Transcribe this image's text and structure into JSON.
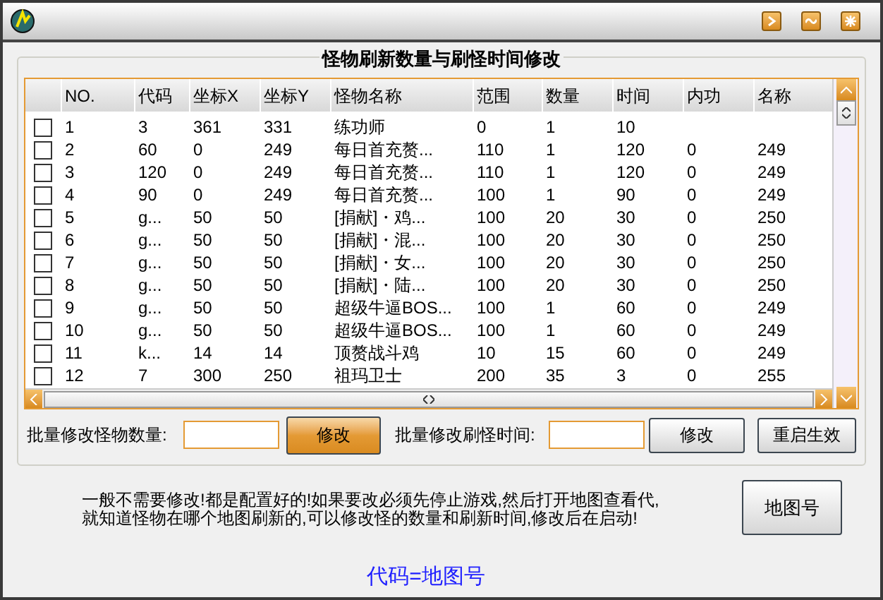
{
  "group_title": "怪物刷新数量与刷怪时间修改",
  "table": {
    "columns": [
      "NO.",
      "代码",
      "坐标X",
      "坐标Y",
      "怪物名称",
      "范围",
      "数量",
      "时间",
      "内功",
      "名称"
    ],
    "rows": [
      {
        "checked": false,
        "cells": [
          "1",
          "3",
          "361",
          "331",
          "练功师",
          "0",
          "1",
          "10",
          "",
          ""
        ]
      },
      {
        "checked": false,
        "cells": [
          "2",
          "60",
          "0",
          "249",
          "每日首充赘...",
          "110",
          "1",
          "120",
          "0",
          "249"
        ]
      },
      {
        "checked": false,
        "cells": [
          "3",
          "120",
          "0",
          "249",
          "每日首充赘...",
          "110",
          "1",
          "120",
          "0",
          "249"
        ]
      },
      {
        "checked": false,
        "cells": [
          "4",
          "90",
          "0",
          "249",
          "每日首充赘...",
          "100",
          "1",
          "90",
          "0",
          "249"
        ]
      },
      {
        "checked": false,
        "cells": [
          "5",
          "g...",
          "50",
          "50",
          "[捐献]・鸡...",
          "100",
          "20",
          "30",
          "0",
          "250"
        ]
      },
      {
        "checked": false,
        "cells": [
          "6",
          "g...",
          "50",
          "50",
          "[捐献]・混...",
          "100",
          "20",
          "30",
          "0",
          "250"
        ]
      },
      {
        "checked": false,
        "cells": [
          "7",
          "g...",
          "50",
          "50",
          "[捐献]・女...",
          "100",
          "20",
          "30",
          "0",
          "250"
        ]
      },
      {
        "checked": false,
        "cells": [
          "8",
          "g...",
          "50",
          "50",
          "[捐献]・陆...",
          "100",
          "20",
          "30",
          "0",
          "250"
        ]
      },
      {
        "checked": false,
        "cells": [
          "9",
          "g...",
          "50",
          "50",
          "超级牛逼BOS...",
          "100",
          "1",
          "60",
          "0",
          "249"
        ]
      },
      {
        "checked": false,
        "cells": [
          "10",
          "g...",
          "50",
          "50",
          "超级牛逼BOS...",
          "100",
          "1",
          "60",
          "0",
          "249"
        ]
      },
      {
        "checked": false,
        "cells": [
          "11",
          "k...",
          "14",
          "14",
          "顶赘战斗鸡",
          "10",
          "15",
          "60",
          "0",
          "249"
        ]
      },
      {
        "checked": false,
        "cells": [
          "12",
          "7",
          "300",
          "250",
          "祖玛卫士",
          "200",
          "35",
          "3",
          "0",
          "255"
        ]
      }
    ]
  },
  "batch_count": {
    "label": "批量修改怪物数量:",
    "button": {
      "label": "修改",
      "highlighted": true
    }
  },
  "batch_time": {
    "label": "批量修改刷怪时间:",
    "button": {
      "label": "修改",
      "highlighted": false
    }
  },
  "restart_button": {
    "label": "重启生效",
    "highlighted": false
  },
  "note_lines": [
    "一般不需要修改!都是配置好的!如果要改必须先停止游戏,然后打开地图查看代,",
    "就知道怪物在哪个地图刷新的,可以修改怪的数量和刷新时间,修改后在启动!"
  ],
  "map_button": {
    "label": "地图号",
    "highlighted": false
  },
  "hint": "代码=地图号"
}
